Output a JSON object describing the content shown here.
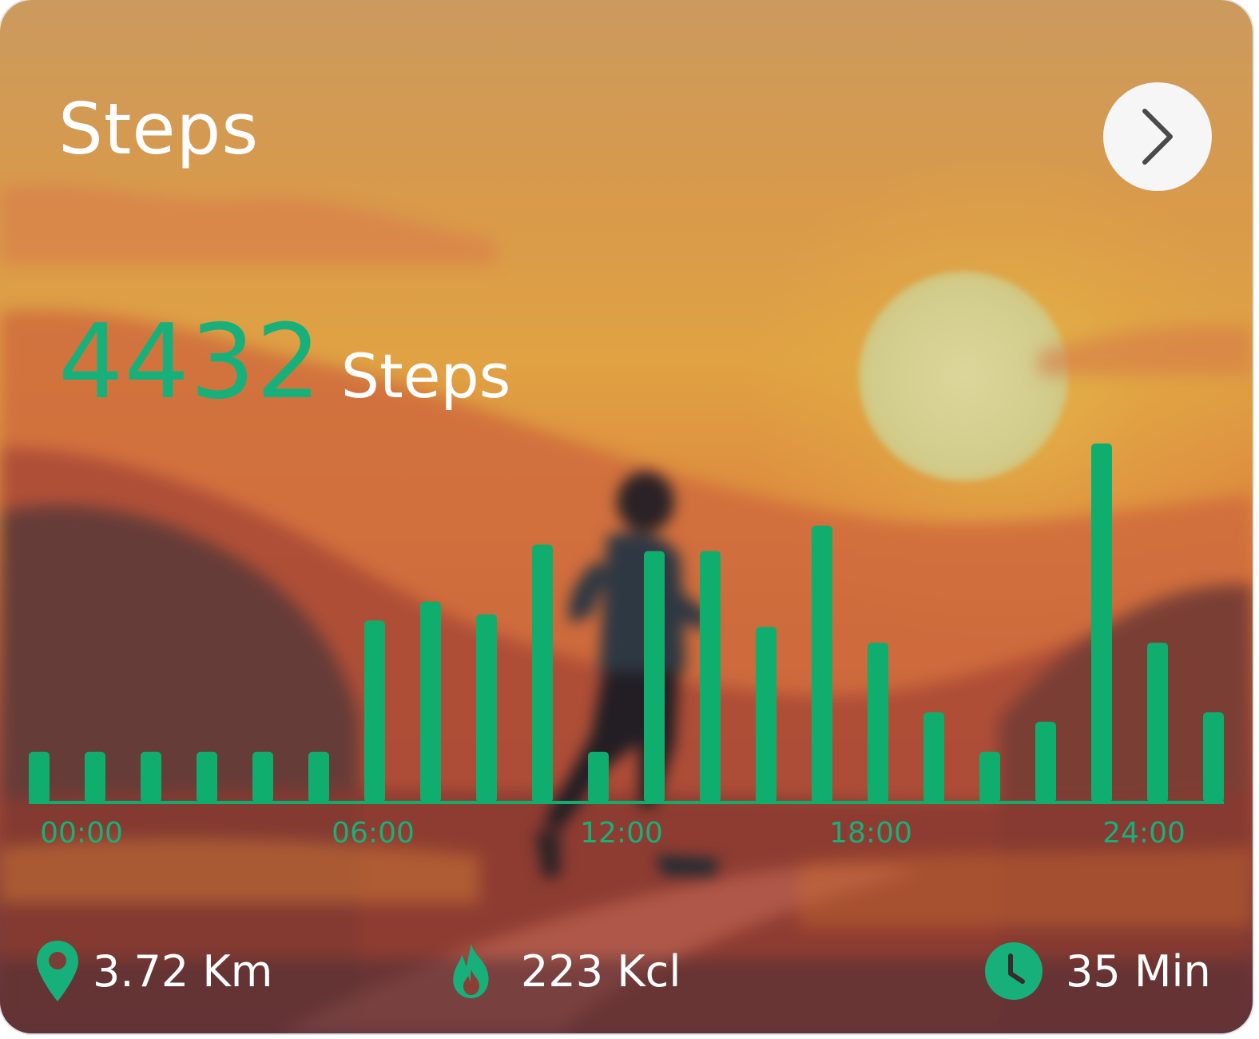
{
  "card": {
    "title": "Steps",
    "next_icon": "chevron-right-icon"
  },
  "summary": {
    "count": "4432",
    "unit": "Steps"
  },
  "chart_data": {
    "type": "bar",
    "color": "#0fae6e",
    "x_tick_labels": [
      "00:00",
      "06:00",
      "12:00",
      "18:00",
      "24:00"
    ],
    "series": [
      {
        "values": [
          32,
          32,
          32,
          32,
          32,
          32,
          115,
          127,
          119,
          163,
          32,
          159,
          159,
          111,
          175,
          101,
          57,
          32,
          51,
          227,
          101,
          57
        ]
      }
    ],
    "y_range": [
      0,
      230
    ],
    "grid": false
  },
  "stats": {
    "distance": {
      "icon": "location-pin-icon",
      "value": "3.72 Km"
    },
    "calories": {
      "icon": "flame-icon",
      "value": "223 Kcl"
    },
    "duration": {
      "icon": "clock-icon",
      "value": "35 Min"
    }
  },
  "colors": {
    "accent": "#17b07a",
    "bar": "#0fae6e",
    "text": "#ffffff",
    "button_bg": "#f6f6f6"
  }
}
